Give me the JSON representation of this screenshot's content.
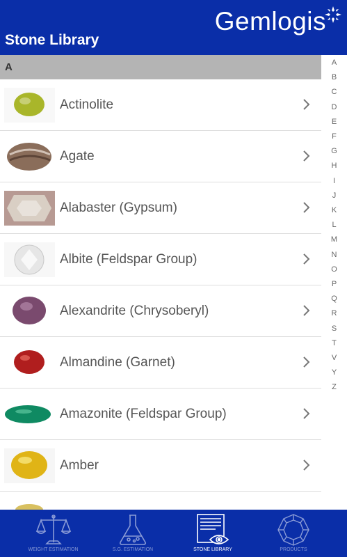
{
  "header": {
    "title": "Stone Library",
    "logo_text": "Gemlogis"
  },
  "section": {
    "letter": "A"
  },
  "stones": [
    {
      "name": "Actinolite",
      "color": "#a9b62a"
    },
    {
      "name": "Agate",
      "color": "#8a6d5a"
    },
    {
      "name": "Alabaster (Gypsum)",
      "color": "#d9cfc4"
    },
    {
      "name": "Albite (Feldspar Group)",
      "color": "#e6e6e6"
    },
    {
      "name": "Alexandrite (Chrysoberyl)",
      "color": "#7a4a6e"
    },
    {
      "name": "Almandine (Garnet)",
      "color": "#b01e1e"
    },
    {
      "name": "Amazonite  (Feldspar Group)",
      "color": "#0f8a62"
    },
    {
      "name": "Amber",
      "color": "#e0b416"
    },
    {
      "name": "",
      "color": "#d8c060"
    }
  ],
  "alphabet": [
    "A",
    "B",
    "C",
    "D",
    "E",
    "F",
    "G",
    "H",
    "I",
    "J",
    "K",
    "L",
    "M",
    "N",
    "O",
    "P",
    "Q",
    "R",
    "S",
    "T",
    "V",
    "Y",
    "Z"
  ],
  "tabs": [
    {
      "label": "WEIGHT ESTIMATION",
      "icon": "scale-icon",
      "active": false
    },
    {
      "label": "S.G. ESTIMATION",
      "icon": "flask-icon",
      "active": false
    },
    {
      "label": "STONE LIBRARY",
      "icon": "library-eye-icon",
      "active": true
    },
    {
      "label": "PRODUCTS",
      "icon": "gem-icon",
      "active": false
    }
  ],
  "colors": {
    "brand_blue": "#0a2ea8",
    "section_gray": "#b4b4b4",
    "tab_inactive": "#8a9bd6"
  }
}
